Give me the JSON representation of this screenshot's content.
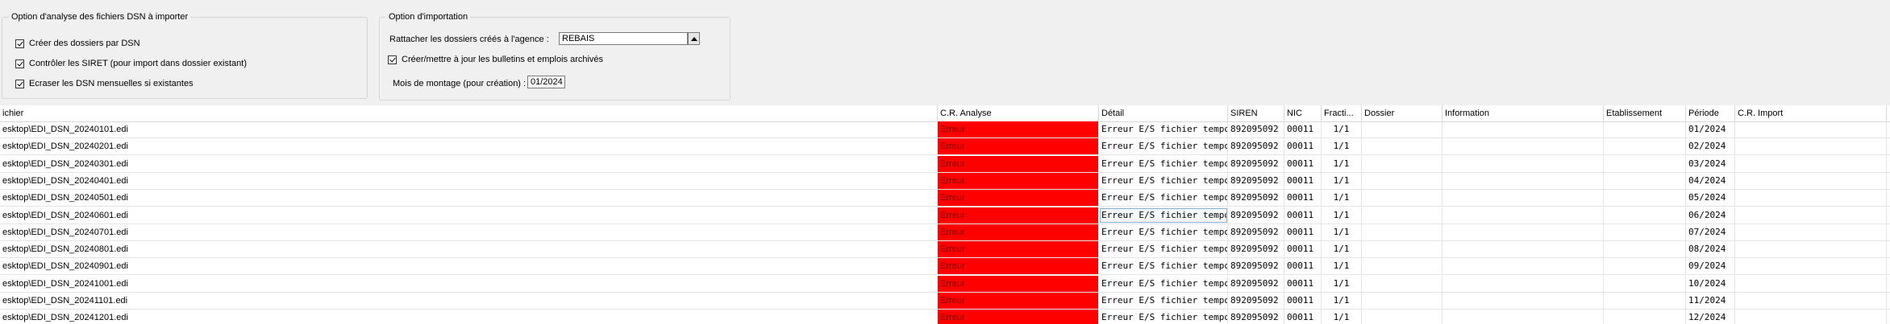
{
  "analysis_group": {
    "title": "Option d'analyse des fichiers DSN à importer",
    "options": [
      {
        "label": "Créer des dossiers par DSN",
        "checked": true
      },
      {
        "label": "Contrôler les SIRET (pour import dans dossier existant)",
        "checked": true
      },
      {
        "label": "Ecraser les DSN mensuelles si existantes",
        "checked": true
      }
    ]
  },
  "import_group": {
    "title": "Option d'importation",
    "agency_label": "Rattacher les dossiers créés à l'agence :",
    "agency_value": "REBAIS",
    "archive_option": {
      "label": "Créer/mettre à jour les bulletins et emplois archivés",
      "checked": true
    },
    "month_label": "Mois de montage (pour création) :",
    "month_value": "01/2024"
  },
  "grid": {
    "columns": [
      "ichier",
      "C.R. Analyse",
      "Détail",
      "SIREN",
      "NIC",
      "Fracti...",
      "Dossier",
      "Information",
      "Etablissement",
      "Période",
      "C.R. Import"
    ],
    "rows": [
      {
        "fichier": "esktop\\EDI_DSN_20240101.edi",
        "cr": "Erreur",
        "detail": "Erreur E/S fichier temporaire",
        "siren": "892095092",
        "nic": "00011",
        "fraction": "1/1",
        "periode": "01/2024"
      },
      {
        "fichier": "esktop\\EDI_DSN_20240201.edi",
        "cr": "Erreur",
        "detail": "Erreur E/S fichier temporaire",
        "siren": "892095092",
        "nic": "00011",
        "fraction": "1/1",
        "periode": "02/2024"
      },
      {
        "fichier": "esktop\\EDI_DSN_20240301.edi",
        "cr": "Erreur",
        "detail": "Erreur E/S fichier temporaire",
        "siren": "892095092",
        "nic": "00011",
        "fraction": "1/1",
        "periode": "03/2024"
      },
      {
        "fichier": "esktop\\EDI_DSN_20240401.edi",
        "cr": "Erreur",
        "detail": "Erreur E/S fichier temporaire",
        "siren": "892095092",
        "nic": "00011",
        "fraction": "1/1",
        "periode": "04/2024"
      },
      {
        "fichier": "esktop\\EDI_DSN_20240501.edi",
        "cr": "Erreur",
        "detail": "Erreur E/S fichier temporaire",
        "siren": "892095092",
        "nic": "00011",
        "fraction": "1/1",
        "periode": "05/2024"
      },
      {
        "fichier": "esktop\\EDI_DSN_20240601.edi",
        "cr": "Erreur",
        "detail": "Erreur E/S fichier temporaire",
        "siren": "892095092",
        "nic": "00011",
        "fraction": "1/1",
        "periode": "06/2024"
      },
      {
        "fichier": "esktop\\EDI_DSN_20240701.edi",
        "cr": "Erreur",
        "detail": "Erreur E/S fichier temporaire",
        "siren": "892095092",
        "nic": "00011",
        "fraction": "1/1",
        "periode": "07/2024"
      },
      {
        "fichier": "esktop\\EDI_DSN_20240801.edi",
        "cr": "Erreur",
        "detail": "Erreur E/S fichier temporaire",
        "siren": "892095092",
        "nic": "00011",
        "fraction": "1/1",
        "periode": "08/2024"
      },
      {
        "fichier": "esktop\\EDI_DSN_20240901.edi",
        "cr": "Erreur",
        "detail": "Erreur E/S fichier temporaire",
        "siren": "892095092",
        "nic": "00011",
        "fraction": "1/1",
        "periode": "09/2024"
      },
      {
        "fichier": "esktop\\EDI_DSN_20241001.edi",
        "cr": "Erreur",
        "detail": "Erreur E/S fichier temporaire",
        "siren": "892095092",
        "nic": "00011",
        "fraction": "1/1",
        "periode": "10/2024"
      },
      {
        "fichier": "esktop\\EDI_DSN_20241101.edi",
        "cr": "Erreur",
        "detail": "Erreur E/S fichier temporaire",
        "siren": "892095092",
        "nic": "00011",
        "fraction": "1/1",
        "periode": "11/2024"
      },
      {
        "fichier": "esktop\\EDI_DSN_20241201.edi",
        "cr": "Erreur",
        "detail": "Erreur E/S fichier temporaire",
        "siren": "892095092",
        "nic": "00011",
        "fraction": "1/1",
        "periode": "12/2024"
      }
    ]
  },
  "colors": {
    "error_cell": "#ff0000",
    "error_text": "#7a0000"
  }
}
